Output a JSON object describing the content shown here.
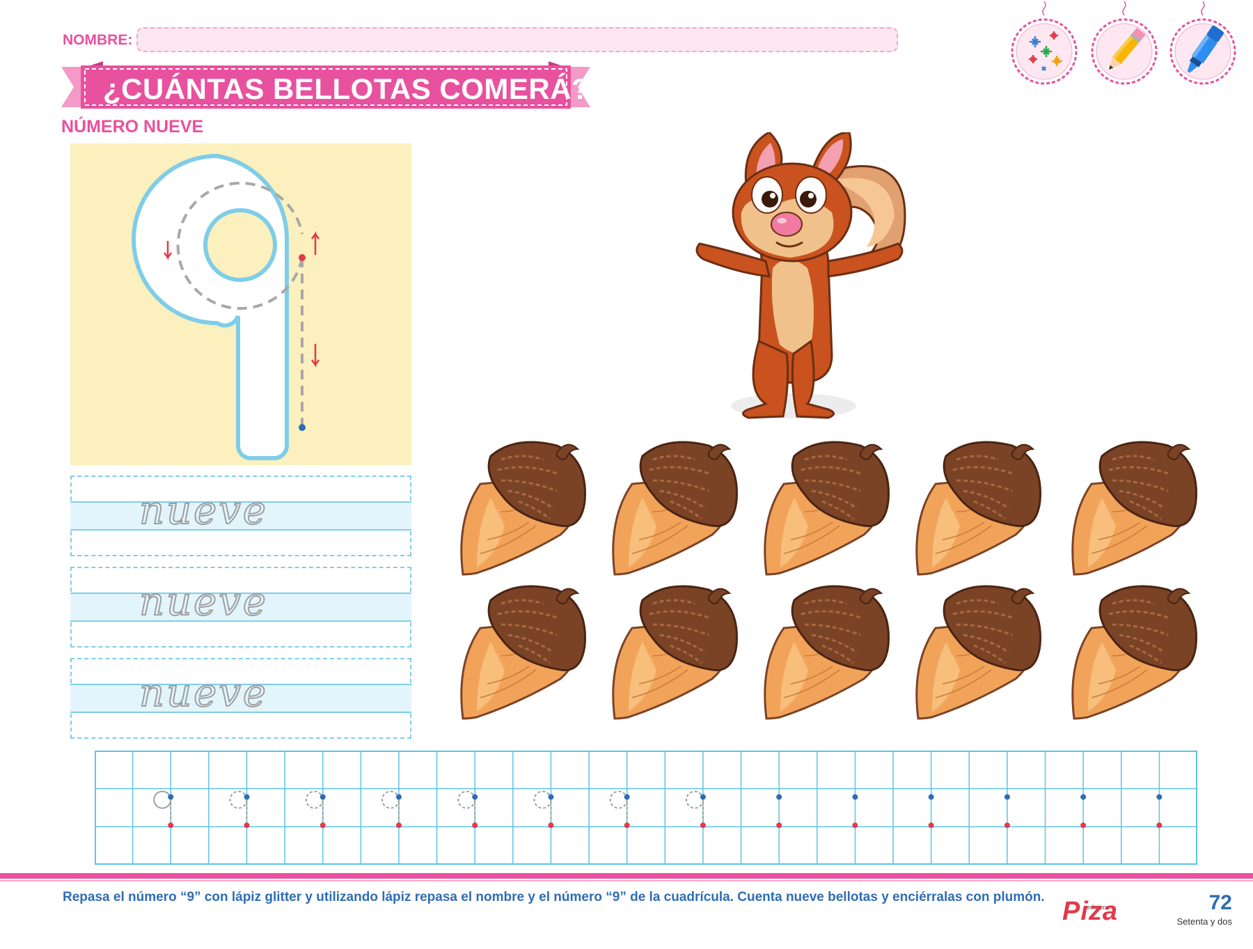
{
  "header": {
    "name_label": "NOMBRE:",
    "title": "¿CUÁNTAS BELLOTAS COMERÁ?",
    "subtitle": "NÚMERO NUEVE"
  },
  "tools": [
    {
      "icon": "glitter-sparkle-icon"
    },
    {
      "icon": "pencil-icon"
    },
    {
      "icon": "marker-icon"
    }
  ],
  "tracing": {
    "digit": "9",
    "word": "nueve",
    "word_practice_lines": 3
  },
  "acorns": {
    "count": 10,
    "rows": 2,
    "per_row": 5
  },
  "grid": {
    "columns": 29,
    "rows": 3,
    "guided_nines": 8,
    "dot_only_cells": 6
  },
  "footer": {
    "instructions": "Repasa el número “9” con lápiz glitter y utilizando lápiz repasa el nombre y el número “9” de la cuadrícula. Cuenta nueve bellotas y enciérralas con plumón.",
    "publisher_small": "ediciones",
    "publisher": "Piza",
    "page_number": "72",
    "page_words": "Setenta y dos"
  },
  "colors": {
    "pink": "#e8519e",
    "blue_text": "#2f6db3",
    "grid_blue": "#5bc4e6",
    "panel_yellow": "#fbf0be",
    "acorn_cap": "#7b4326",
    "acorn_nut": "#f2a35a"
  }
}
